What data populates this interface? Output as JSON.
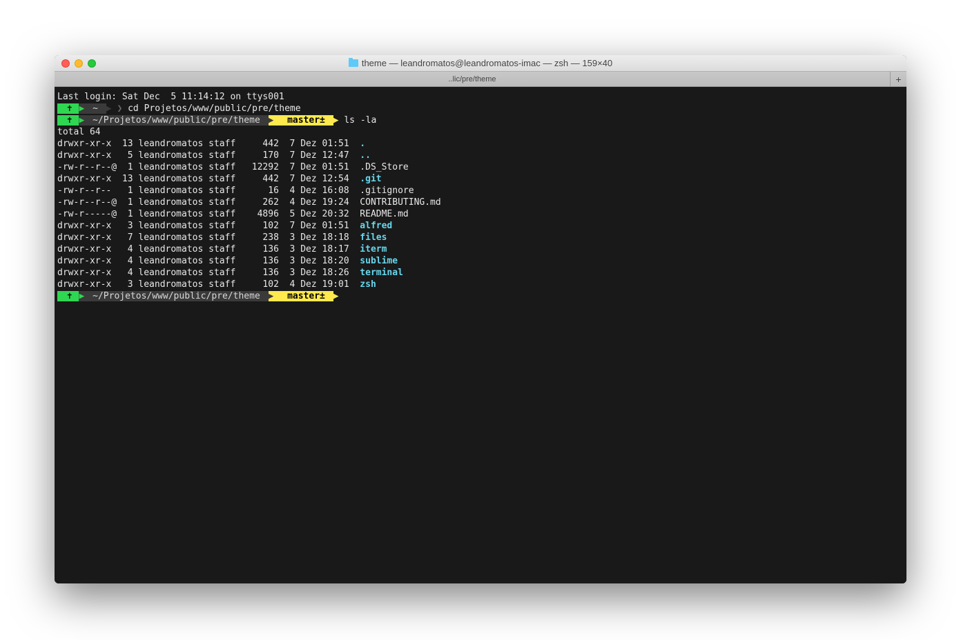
{
  "window": {
    "title": "theme — leandromatos@leandromatos-imac — zsh — 159×40",
    "tab": "..lic/pre/theme",
    "newtab": "+"
  },
  "terminal": {
    "last_login": "Last login: Sat Dec  5 11:14:12 on ttys001",
    "prompt1": {
      "anchor": "✝",
      "path": "~",
      "chev": "❯",
      "cmd": "cd Projetos/www/public/pre/theme"
    },
    "prompt2": {
      "anchor": "✝",
      "path": "~/Projetos/www/public/pre/theme",
      "branch_icon": "",
      "branch": "master±",
      "cmd": "ls -la"
    },
    "total": "total 64",
    "listing": [
      {
        "perm": "drwxr-xr-x",
        "links": "13",
        "user": "leandromatos",
        "group": "staff",
        "size": "442",
        "date": "7 Dez 01:51",
        "name": ".",
        "dir": true
      },
      {
        "perm": "drwxr-xr-x",
        "links": "5",
        "user": "leandromatos",
        "group": "staff",
        "size": "170",
        "date": "7 Dez 12:47",
        "name": "..",
        "dir": true
      },
      {
        "perm": "-rw-r--r--@",
        "links": "1",
        "user": "leandromatos",
        "group": "staff",
        "size": "12292",
        "date": "7 Dez 01:51",
        "name": ".DS_Store",
        "dir": false
      },
      {
        "perm": "drwxr-xr-x",
        "links": "13",
        "user": "leandromatos",
        "group": "staff",
        "size": "442",
        "date": "7 Dez 12:54",
        "name": ".git",
        "dir": true
      },
      {
        "perm": "-rw-r--r--",
        "links": "1",
        "user": "leandromatos",
        "group": "staff",
        "size": "16",
        "date": "4 Dez 16:08",
        "name": ".gitignore",
        "dir": false
      },
      {
        "perm": "-rw-r--r--@",
        "links": "1",
        "user": "leandromatos",
        "group": "staff",
        "size": "262",
        "date": "4 Dez 19:24",
        "name": "CONTRIBUTING.md",
        "dir": false
      },
      {
        "perm": "-rw-r-----@",
        "links": "1",
        "user": "leandromatos",
        "group": "staff",
        "size": "4896",
        "date": "5 Dez 20:32",
        "name": "README.md",
        "dir": false
      },
      {
        "perm": "drwxr-xr-x",
        "links": "3",
        "user": "leandromatos",
        "group": "staff",
        "size": "102",
        "date": "7 Dez 01:51",
        "name": "alfred",
        "dir": true
      },
      {
        "perm": "drwxr-xr-x",
        "links": "7",
        "user": "leandromatos",
        "group": "staff",
        "size": "238",
        "date": "3 Dez 18:18",
        "name": "files",
        "dir": true
      },
      {
        "perm": "drwxr-xr-x",
        "links": "4",
        "user": "leandromatos",
        "group": "staff",
        "size": "136",
        "date": "3 Dez 18:17",
        "name": "iterm",
        "dir": true
      },
      {
        "perm": "drwxr-xr-x",
        "links": "4",
        "user": "leandromatos",
        "group": "staff",
        "size": "136",
        "date": "3 Dez 18:20",
        "name": "sublime",
        "dir": true
      },
      {
        "perm": "drwxr-xr-x",
        "links": "4",
        "user": "leandromatos",
        "group": "staff",
        "size": "136",
        "date": "3 Dez 18:26",
        "name": "terminal",
        "dir": true
      },
      {
        "perm": "drwxr-xr-x",
        "links": "3",
        "user": "leandromatos",
        "group": "staff",
        "size": "102",
        "date": "4 Dez 19:01",
        "name": "zsh",
        "dir": true
      }
    ],
    "prompt3": {
      "anchor": "✝",
      "path": "~/Projetos/www/public/pre/theme",
      "branch_icon": "",
      "branch": "master±"
    }
  },
  "colors": {
    "prompt_green": "#2fd651",
    "prompt_yellow": "#ffe94e",
    "dir_cyan": "#67d6ed",
    "bg": "#191919"
  }
}
